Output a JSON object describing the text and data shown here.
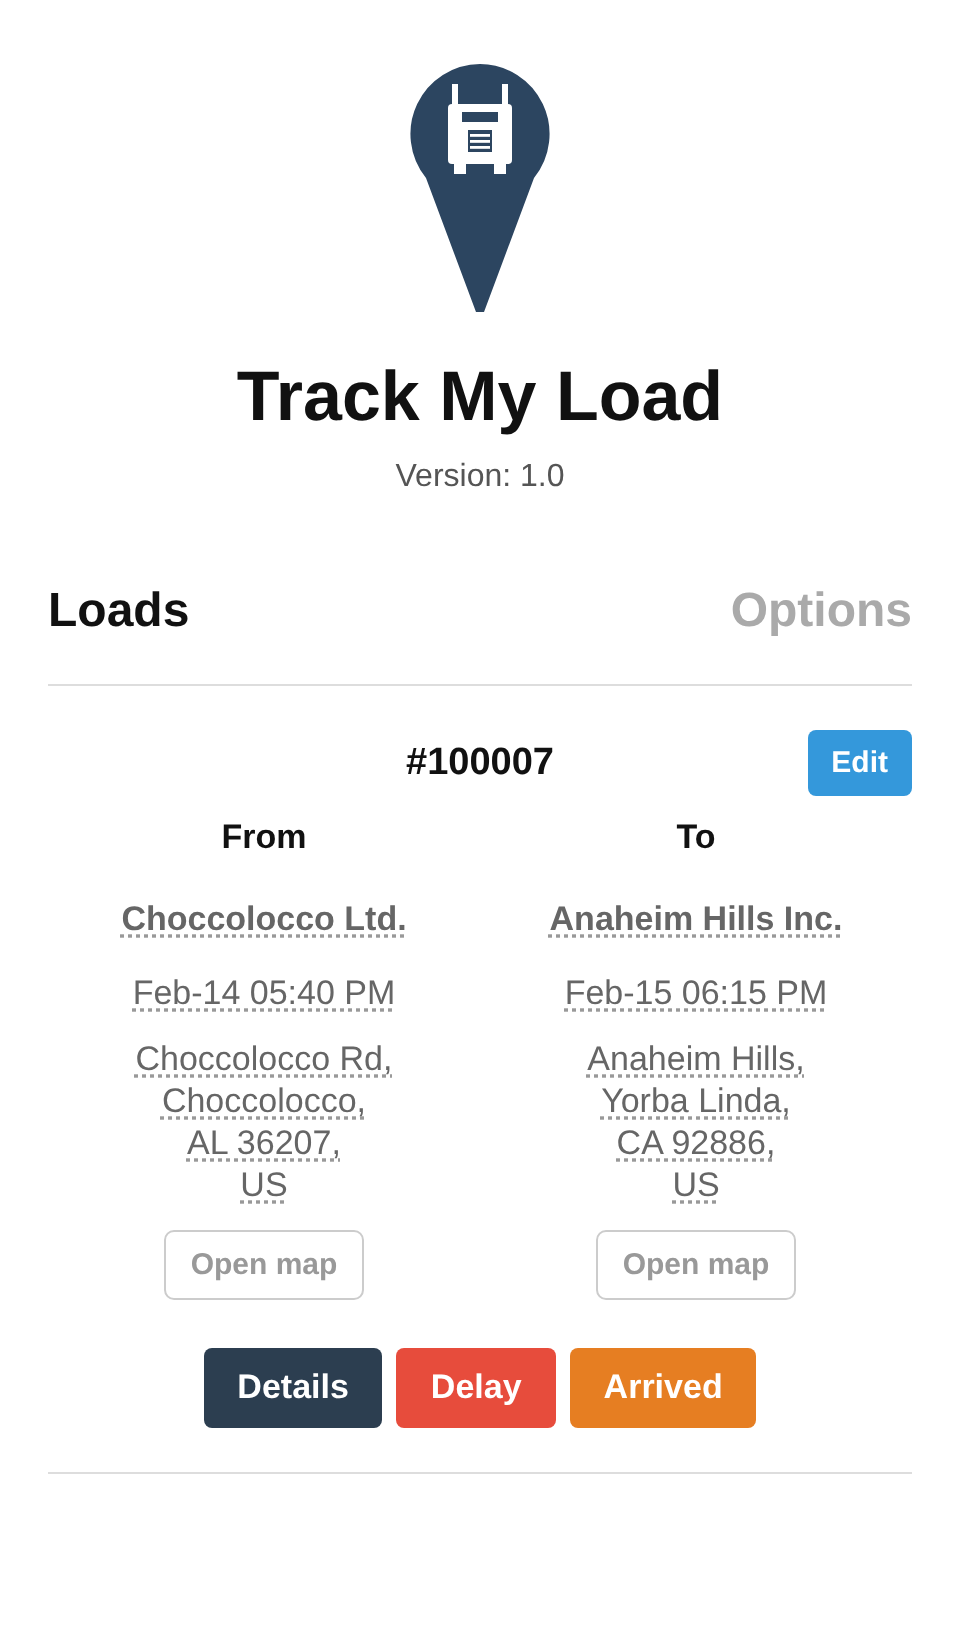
{
  "app": {
    "title": "Track My Load",
    "version": "Version: 1.0"
  },
  "tabs": [
    {
      "label": "Loads",
      "selected": true
    },
    {
      "label": "Options",
      "selected": false
    }
  ],
  "load": {
    "number": "#100007",
    "edit_button": "Edit",
    "stops": [
      {
        "heading": "From",
        "company": "Choccolocco Ltd.",
        "time": "Feb-14 05:40 PM",
        "address": [
          "Choccolocco Rd,",
          "Choccolocco,",
          "AL 36207,",
          "US"
        ],
        "map_button": "Open map"
      },
      {
        "heading": "To",
        "company": "Anaheim Hills Inc.",
        "time": "Feb-15 06:15 PM",
        "address": [
          "Anaheim Hills,",
          "Yorba Linda,",
          "CA 92886,",
          "US"
        ],
        "map_button": "Open map"
      }
    ],
    "actions": [
      {
        "label": "Details",
        "color": "#2c3e50"
      },
      {
        "label": "Delay",
        "color": "#e74c3c"
      },
      {
        "label": "Arrived",
        "color": "#e67e22"
      }
    ]
  }
}
